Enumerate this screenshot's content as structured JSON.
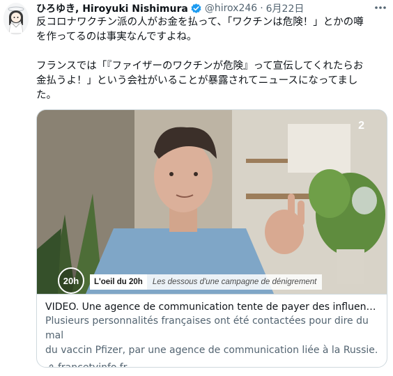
{
  "tweet": {
    "author_name": "ひろゆき, Hiroyuki Nishimura",
    "handle": "@hirox246",
    "separator": "·",
    "date": "6月22日",
    "text_line1": "反コロナワクチン派の人がお金を払って、「ワクチンは危険！」とかの噂",
    "text_line2": "を作ってるのは事実なんですよね。",
    "text_line3": "フランスでは「『ファイザーのワクチンが危険』って宣伝してくれたらお",
    "text_line4": "金払うよ！」という会社がいることが暴露されてニュースになってまし",
    "text_line5": "た。"
  },
  "card": {
    "title": "VIDEO. Une agence de communication tente de payer des influenceurs...",
    "description_line1": "Plusieurs personnalités françaises ont été contactées pour dire du mal",
    "description_line2": "du vaccin Pfizer, par une agence de communication liée à la Russie.",
    "domain": "francetvinfo.fr"
  },
  "video": {
    "badge": "20h",
    "show_title": "L'oeil du 20h",
    "subtitle": "Les dessous d'une campagne de dénigrement",
    "channel": "2"
  },
  "icons": {
    "more": "more-horizontal-icon",
    "verified": "verified-badge-icon",
    "link": "link-icon"
  },
  "colors": {
    "text": "#0f1419",
    "secondary": "#536471",
    "verified": "#1d9bf0",
    "border": "#cfd9de"
  }
}
